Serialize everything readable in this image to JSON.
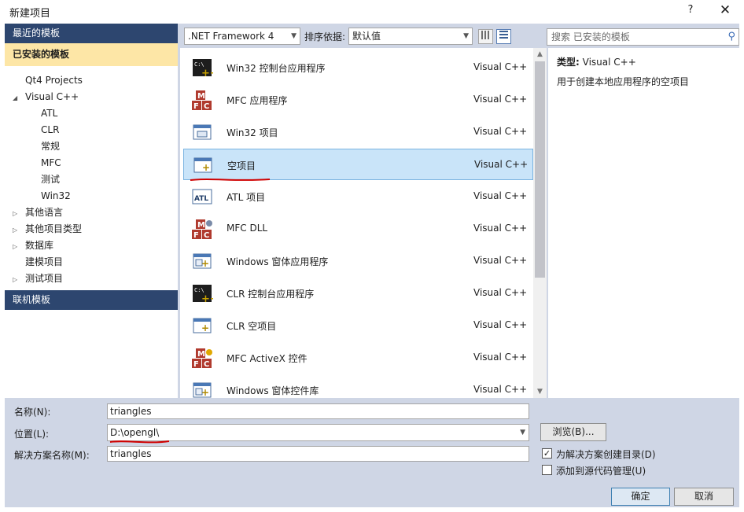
{
  "window": {
    "title": "新建项目",
    "help": "?",
    "close": "✕"
  },
  "nav": {
    "recent": "最近的模板",
    "installed": "已安装的模板",
    "online": "联机模板",
    "tree": [
      {
        "label": "Qt4 Projects",
        "arrow": ""
      },
      {
        "label": "Visual C++",
        "arrow": "◢"
      },
      {
        "label": "ATL",
        "arrow": ""
      },
      {
        "label": "CLR",
        "arrow": ""
      },
      {
        "label": "常规",
        "arrow": ""
      },
      {
        "label": "MFC",
        "arrow": ""
      },
      {
        "label": "测试",
        "arrow": ""
      },
      {
        "label": "Win32",
        "arrow": ""
      },
      {
        "label": "其他语言",
        "arrow": "▷"
      },
      {
        "label": "其他项目类型",
        "arrow": "▷"
      },
      {
        "label": "数据库",
        "arrow": "▷"
      },
      {
        "label": "建模项目",
        "arrow": ""
      },
      {
        "label": "测试项目",
        "arrow": "▷"
      }
    ]
  },
  "toolbar": {
    "framework": ".NET Framework 4",
    "sort_label": "排序依据:",
    "sort_value": "默认值"
  },
  "search": {
    "placeholder": "搜索 已安装的模板"
  },
  "templates": [
    {
      "name": "Win32 控制台应用程序",
      "lang": "Visual C++",
      "icon": "console-icon"
    },
    {
      "name": "MFC 应用程序",
      "lang": "Visual C++",
      "icon": "mfc-icon"
    },
    {
      "name": "Win32 项目",
      "lang": "Visual C++",
      "icon": "window-icon"
    },
    {
      "name": "空项目",
      "lang": "Visual C++",
      "icon": "empty-project-icon"
    },
    {
      "name": "ATL 项目",
      "lang": "Visual C++",
      "icon": "atl-icon"
    },
    {
      "name": "MFC DLL",
      "lang": "Visual C++",
      "icon": "mfc-dll-icon"
    },
    {
      "name": "Windows 窗体应用程序",
      "lang": "Visual C++",
      "icon": "winforms-icon"
    },
    {
      "name": "CLR 控制台应用程序",
      "lang": "Visual C++",
      "icon": "console-icon"
    },
    {
      "name": "CLR 空项目",
      "lang": "Visual C++",
      "icon": "empty-project-icon"
    },
    {
      "name": "MFC ActiveX 控件",
      "lang": "Visual C++",
      "icon": "mfc-activex-icon"
    },
    {
      "name": "Windows 窗体控件库",
      "lang": "Visual C++",
      "icon": "winforms-icon"
    }
  ],
  "selected_template_index": 3,
  "description": {
    "type_label": "类型:",
    "type_value": "Visual C++",
    "text": "用于创建本地应用程序的空项目"
  },
  "form": {
    "name_label": "名称(N):",
    "name_value": "triangles",
    "location_label": "位置(L):",
    "location_value": "D:\\opengl\\",
    "solution_label": "解决方案名称(M):",
    "solution_value": "triangles",
    "browse": "浏览(B)...",
    "create_dir": "为解决方案创建目录(D)",
    "create_dir_checked": true,
    "source_control": "添加到源代码管理(U)",
    "source_control_checked": false
  },
  "buttons": {
    "ok": "确定",
    "cancel": "取消"
  },
  "colors": {
    "nav_header": "#2d466f",
    "nav_selected": "#fde6a6",
    "selection": "#c9e4f9",
    "frame": "#cfd6e5",
    "annotation": "#d00000"
  }
}
